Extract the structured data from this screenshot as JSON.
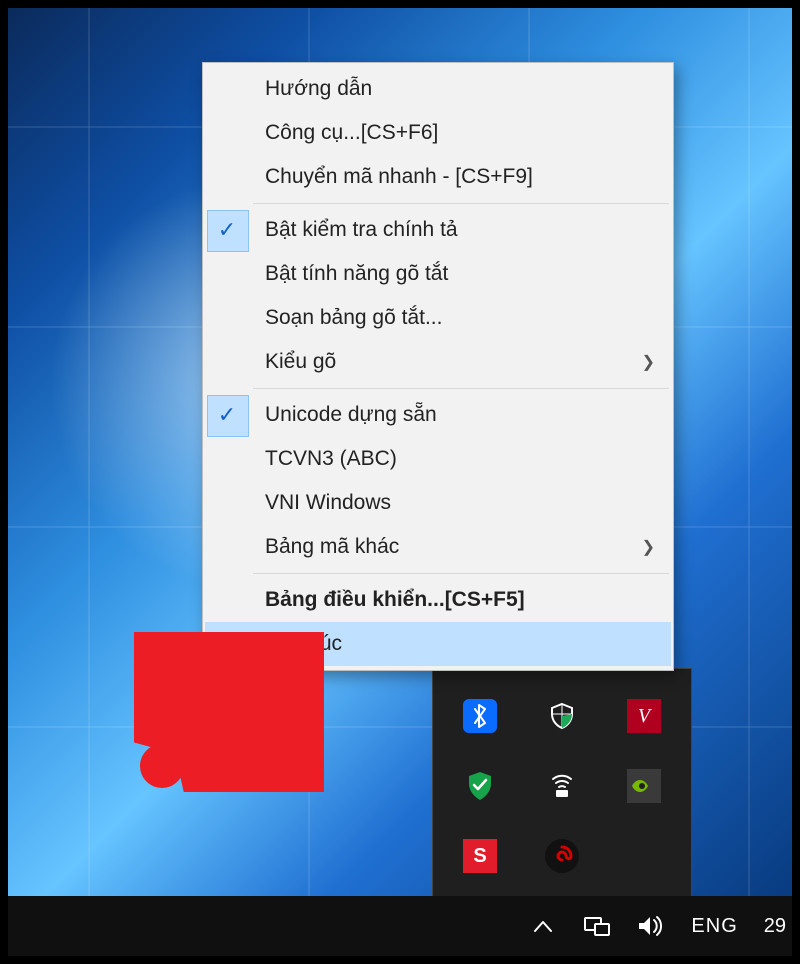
{
  "menu": {
    "group1": [
      {
        "label": "Hướng dẫn"
      },
      {
        "label": "Công cụ...[CS+F6]"
      },
      {
        "label": "Chuyển mã nhanh - [CS+F9]"
      }
    ],
    "group2": [
      {
        "label": "Bật kiểm tra chính tả",
        "checked": true
      },
      {
        "label": "Bật tính năng gõ tắt"
      },
      {
        "label": "Soạn bảng gõ tắt..."
      },
      {
        "label": "Kiểu gõ",
        "submenu": true
      }
    ],
    "group3": [
      {
        "label": "Unicode dựng sẵn",
        "checked": true
      },
      {
        "label": "TCVN3 (ABC)"
      },
      {
        "label": "VNI Windows"
      },
      {
        "label": "Bảng mã khác",
        "submenu": true
      }
    ],
    "group4": [
      {
        "label": "Bảng điều khiển...[CS+F5]",
        "bold": true
      },
      {
        "label": "Kết thúc",
        "highlighted": true
      }
    ]
  },
  "tray_icons": {
    "bluetooth": "bluetooth-icon",
    "security": "windows-security-icon",
    "v": "V",
    "shield": "antivirus-shield-icon",
    "wifi": "network-icon",
    "nvidia": "nvidia-icon",
    "s": "S",
    "garena": "garena-icon"
  },
  "taskbar": {
    "show_hidden": "show-hidden-icons",
    "network": "network-status-icon",
    "volume": "volume-icon",
    "language": "ENG",
    "time": "29"
  },
  "colors": {
    "highlight": "#bfe0ff",
    "menu_bg": "#f2f2f2",
    "arrow": "#ec1d24"
  }
}
